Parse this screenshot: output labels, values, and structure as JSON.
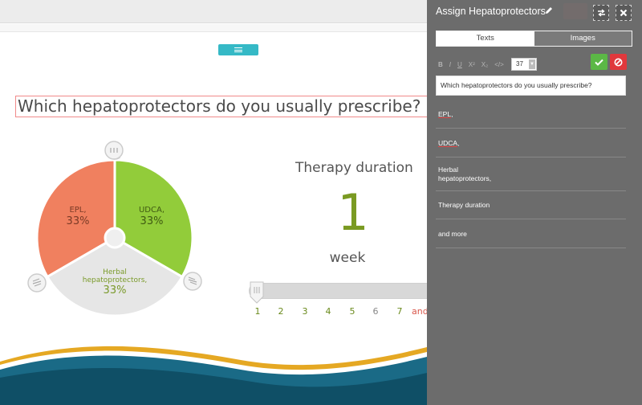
{
  "slide": {
    "question": "Which hepatoprotectors do you usually prescribe?",
    "pie": {
      "slices": [
        {
          "label": "EPL,",
          "percent": "33%",
          "color": "#f0805f"
        },
        {
          "label": "UDCA,",
          "percent": "33%",
          "color": "#92cc3a"
        },
        {
          "label": "Herbal hepatoprotectors,",
          "percent": "33%",
          "color": "#e6e6e6"
        }
      ]
    },
    "duration": {
      "title": "Therapy duration",
      "value": "1",
      "unit": "week",
      "slider_value": 1,
      "ticks": [
        "1",
        "2",
        "3",
        "4",
        "5",
        "6",
        "7",
        "and more"
      ]
    }
  },
  "panel": {
    "title": "Assign Hepatoprotectors",
    "tabs": {
      "texts": "Texts",
      "images": "Images"
    },
    "toolbar": {
      "bold": "B",
      "italic": "I",
      "underline": "U",
      "superscript": "X²",
      "subscript": "X₂",
      "code": "</>",
      "font_size": "37"
    },
    "question_value": "Which hepatoprotectors do you usually prescribe?",
    "answers": [
      "EPL,",
      "UDCA,",
      "Herbal hepatoprotectors,",
      "Therapy duration",
      "and more"
    ]
  },
  "colors": {
    "accent_green": "#7a9a22",
    "panel_bg": "#6c6c6c",
    "confirm_green": "#5bb846",
    "cancel_red": "#e0383c",
    "menu_teal": "#35b9c6"
  }
}
